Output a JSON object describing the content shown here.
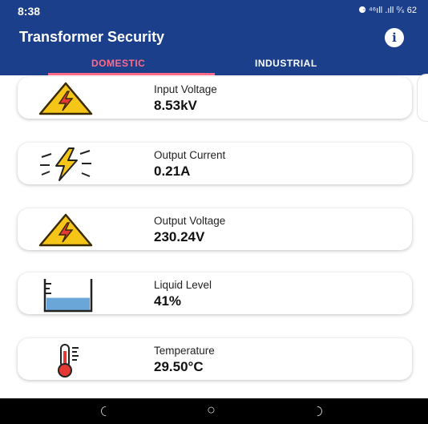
{
  "status": {
    "time": "8:38",
    "indicators": "⚈ ⁴⁶ıll .ıll ⁰⁄ₛ 62"
  },
  "app": {
    "title": "Transformer Security",
    "info_icon": "i"
  },
  "tabs": [
    {
      "label": "DOMESTIC",
      "active": true
    },
    {
      "label": "INDUSTRIAL",
      "active": false
    }
  ],
  "colors": {
    "primary": "#1b3f8b",
    "accent": "#ff6b8a",
    "warning_yellow": "#f5c518"
  },
  "readings": [
    {
      "label": "Input Voltage",
      "value": "8.53kV",
      "icon": "high-voltage-warning-icon"
    },
    {
      "label": "Output Current",
      "value": "0.21A",
      "icon": "lightning-bolt-icon"
    },
    {
      "label": "Output Voltage",
      "value": "230.24V",
      "icon": "high-voltage-warning-icon"
    },
    {
      "label": "Liquid Level",
      "value": "41%",
      "icon": "beaker-icon",
      "level": 0.41
    },
    {
      "label": "Temperature",
      "value": "29.50°C",
      "icon": "thermometer-icon"
    }
  ],
  "nav": {
    "recent": "◡",
    "home": "○",
    "back": "◡"
  }
}
